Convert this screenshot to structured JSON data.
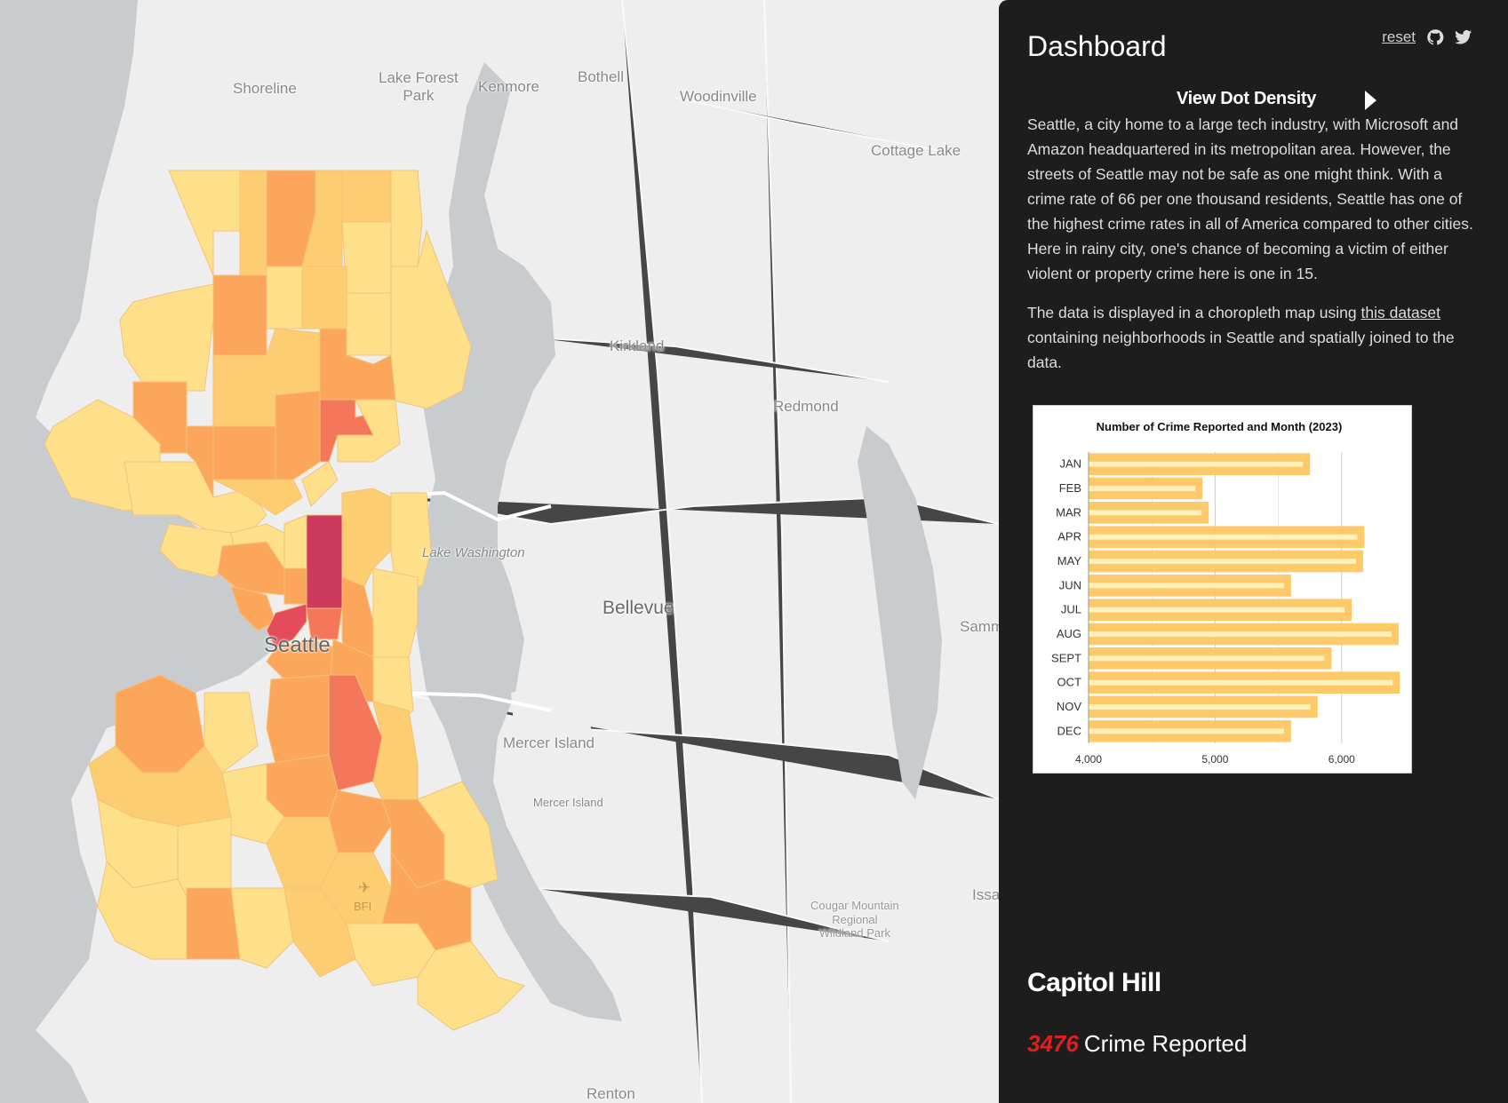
{
  "map": {
    "labels": {
      "shoreline": "Shoreline",
      "lake_forest_park": "Lake Forest\nPark",
      "kenmore": "Kenmore",
      "bothell": "Bothell",
      "woodinville": "Woodinville",
      "cottage_lake": "Cottage Lake",
      "kirkland": "Kirkland",
      "redmond": "Redmond",
      "lake_washington": "Lake Washington",
      "bellevue": "Bellevue",
      "seattle": "Seattle",
      "mercer_island_major": "Mercer Island",
      "mercer_island_minor": "Mercer Island",
      "sammamish": "Samm",
      "issaquah": "Issa",
      "cougar_mountain": "Cougar Mountain\nRegional\nWildland Park",
      "renton": "Renton",
      "bfi": "BFI"
    },
    "colors": {
      "water": "#c8ccce",
      "land": "#eeeeee",
      "lightest": "#fee08b",
      "light": "#fdcd72",
      "medium": "#fca65b",
      "dark": "#f4775b",
      "darker": "#e54c5b",
      "darkest": "#cc3a5e"
    }
  },
  "panel": {
    "title": "Dashboard",
    "reset": "reset",
    "icons": [
      "github-icon",
      "twitter-icon"
    ],
    "toggle_label": "View Dot Density",
    "paragraph1": "Seattle, a city home to a large tech industry, with Microsoft and Amazon headquartered in its metropolitan area. However, the streets of Seattle may not be safe as one might think. With a crime rate of 66 per one thousand residents, Seattle has one of the highest crime rates in all of America compared to other cities. Here in rainy city, one's chance of becoming a victim of either violent or property crime here is one in 15.",
    "paragraph2_pre": "The data is displayed in a choropleth map using ",
    "paragraph2_link": "this dataset",
    "paragraph2_post": " containing neighborhoods in Seattle and spatially joined to the data.",
    "region_name": "Capitol Hill",
    "crime_count": "3476",
    "crime_suffix": "Crime Reported"
  },
  "chart_data": {
    "type": "bar",
    "title": "Number of Crime Reported and Month (2023)",
    "categories": [
      "JAN",
      "FEB",
      "MAR",
      "APR",
      "MAY",
      "JUN",
      "JUL",
      "AUG",
      "SEPT",
      "OCT",
      "NOV",
      "DEC"
    ],
    "values": [
      5750,
      4900,
      4950,
      6180,
      6170,
      5600,
      6080,
      6450,
      5920,
      6460,
      5810,
      5600
    ],
    "ticks": [
      4000,
      5000,
      6000
    ],
    "tick_labels": [
      "4,000",
      "5,000",
      "6,000"
    ],
    "xlim": [
      4000,
      6500
    ],
    "bar_color": "#fdc45c",
    "orientation": "horizontal",
    "grid": true
  }
}
